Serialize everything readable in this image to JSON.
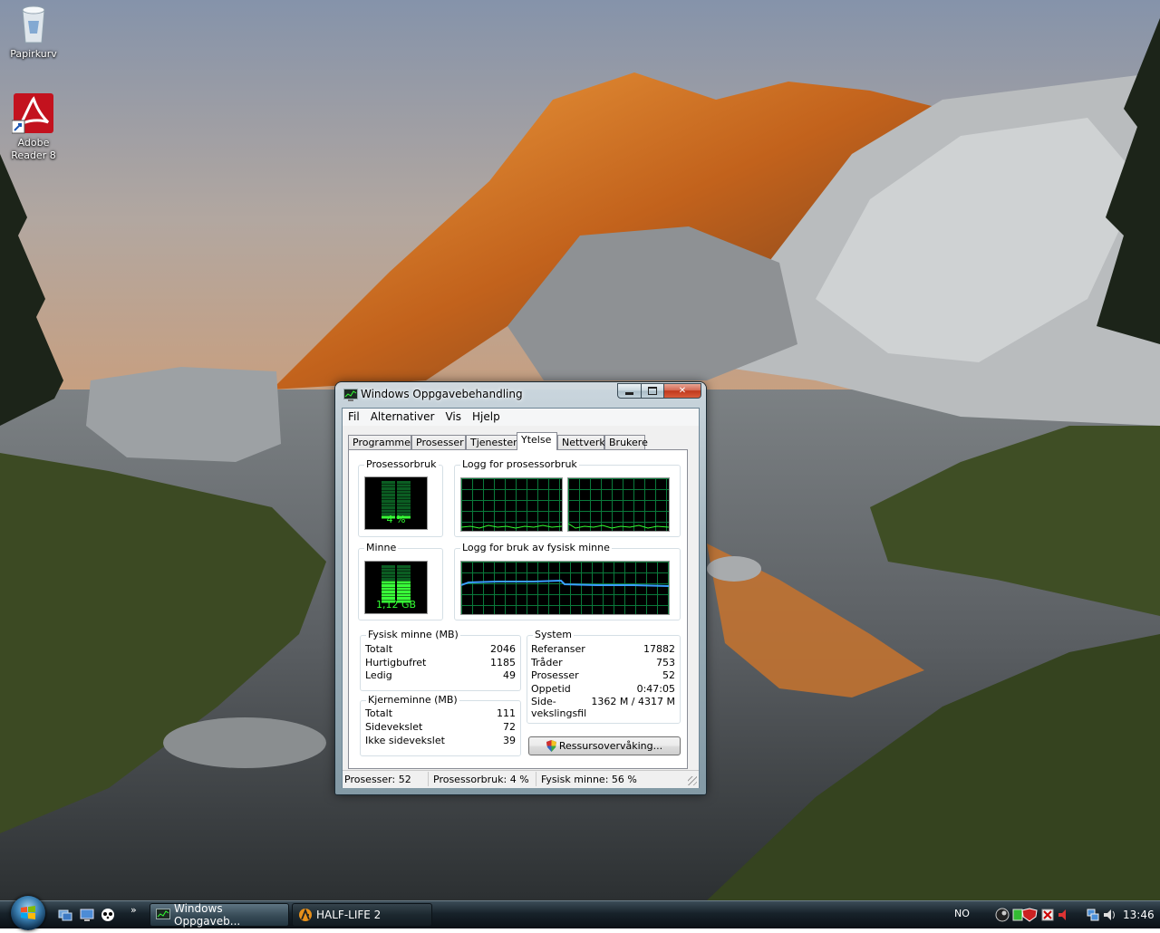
{
  "desktop": {
    "icons": [
      {
        "label": "Papirkurv",
        "icon": "recycle-bin-icon"
      },
      {
        "label_line1": "Adobe",
        "label_line2": "Reader 8",
        "icon": "adobe-reader-icon"
      }
    ]
  },
  "window": {
    "title": "Windows Oppgavebehandling",
    "menu": [
      "Fil",
      "Alternativer",
      "Vis",
      "Hjelp"
    ],
    "tabs": [
      "Programmer",
      "Prosesser",
      "Tjenester",
      "Ytelse",
      "Nettverk",
      "Brukere"
    ],
    "active_tab": "Ytelse",
    "cpu_group": "Prosessorbruk",
    "cpu_value": "4 %",
    "cpu_usage_fraction": 0.04,
    "cpu_history_group": "Logg for prosessorbruk",
    "mem_group": "Minne",
    "mem_value": "1,12 GB",
    "mem_usage_fraction": 0.56,
    "mem_history_group": "Logg for bruk av fysisk minne",
    "physical": {
      "group": "Fysisk minne (MB)",
      "rows": [
        {
          "label": "Totalt",
          "value": "2046"
        },
        {
          "label": "Hurtigbufret",
          "value": "1185"
        },
        {
          "label": "Ledig",
          "value": "49"
        }
      ]
    },
    "kernel": {
      "group": "Kjerneminne (MB)",
      "rows": [
        {
          "label": "Totalt",
          "value": "111"
        },
        {
          "label": "Sidevekslet",
          "value": "72"
        },
        {
          "label": "Ikke sidevekslet",
          "value": "39"
        }
      ]
    },
    "system": {
      "group": "System",
      "rows": [
        {
          "label": "Referanser",
          "value": "17882"
        },
        {
          "label": "Tråder",
          "value": "753"
        },
        {
          "label": "Prosesser",
          "value": "52"
        },
        {
          "label": "Oppetid",
          "value": "0:47:05"
        }
      ],
      "pagefile_label_1": "Side-",
      "pagefile_label_2": "vekslingsfil",
      "pagefile_value": "1362 M / 4317 M"
    },
    "resource_button": "Ressursovervåking...",
    "status": {
      "processes": "Prosesser: 52",
      "cpu": "Prosessorbruk: 4 %",
      "memory": "Fysisk minne: 56 %"
    }
  },
  "taskbar": {
    "buttons": [
      {
        "label": "Windows Oppgaveb...",
        "icon": "task-manager-icon"
      },
      {
        "label": "HALF-LIFE 2",
        "icon": "half-life-icon"
      }
    ],
    "language": "NO",
    "clock": "13:46",
    "tray_icons": [
      "steam-icon",
      "network-icon",
      "shield-icon",
      "security-icon",
      "speaker-mute-icon",
      "network-connection-icon",
      "volume-icon"
    ]
  }
}
